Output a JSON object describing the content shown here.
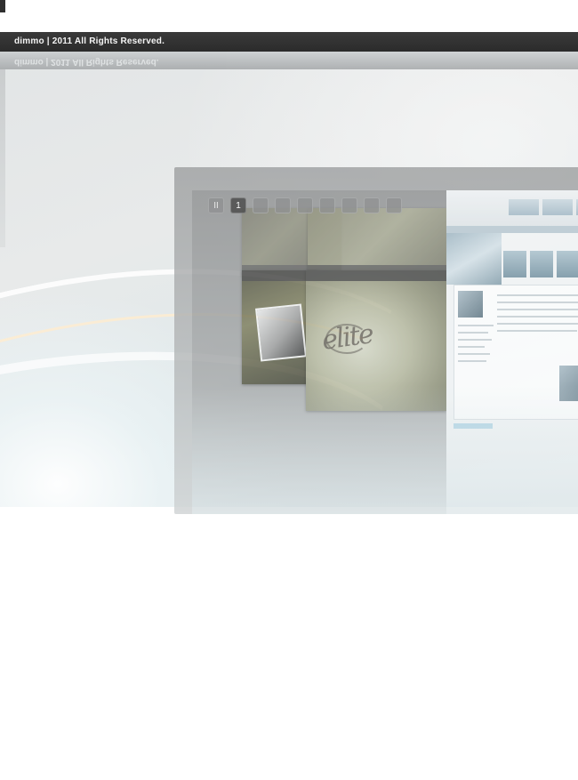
{
  "footer": {
    "copyright": "dimmo  |  2011 All Rights Reserved.",
    "copyright_reflection": "dimmo  |  2011 All Rights Reserved."
  },
  "viewer_toolbar": {
    "buttons": [
      {
        "icon": "pause-icon",
        "label": "II",
        "active": false
      },
      {
        "icon": "slide-1-icon",
        "label": "1",
        "active": true
      },
      {
        "icon": "slide-2-icon",
        "label": "",
        "active": false
      },
      {
        "icon": "slide-3-icon",
        "label": "",
        "active": false
      },
      {
        "icon": "slide-4-icon",
        "label": "",
        "active": false
      },
      {
        "icon": "slide-5-icon",
        "label": "",
        "active": false
      },
      {
        "icon": "slide-6-icon",
        "label": "",
        "active": false
      },
      {
        "icon": "slide-7-icon",
        "label": "",
        "active": false
      },
      {
        "icon": "slide-8-icon",
        "label": "",
        "active": false
      }
    ]
  },
  "colors": {
    "bar_dark": "#2f2f2f",
    "background": "#e2e5e6",
    "active_button": "#2d2d2d"
  }
}
